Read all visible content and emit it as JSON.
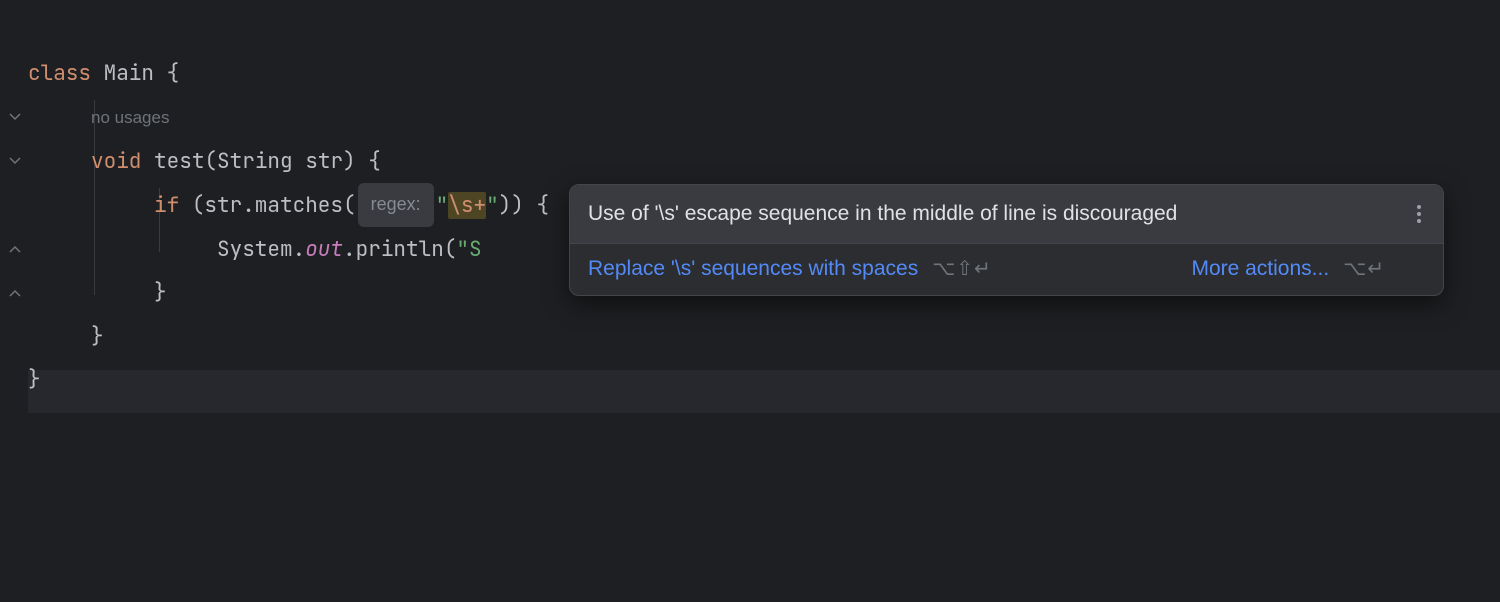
{
  "code": {
    "kw_class": "class",
    "class_name": "Main",
    "brace_open": " {",
    "usage_hint": "no usages",
    "kw_void": "void",
    "method_name": "test",
    "params_open": "(",
    "param_type": "String",
    "param_name": " str",
    "params_close": ") {",
    "kw_if": "if",
    "if_open": " (str.matches(",
    "param_hint": " regex: ",
    "str_open": "\"",
    "str_esc": "\\s+",
    "str_close": "\"",
    "if_close": ")) {",
    "sys": "System.",
    "out": "out",
    "println_open": ".println(",
    "println_arg_q": "\"",
    "println_arg_rest": "S",
    "inner_close": "}",
    "method_close": "}",
    "class_close": "}"
  },
  "popup": {
    "title": "Use of '\\s' escape sequence in the middle of line is discouraged",
    "action_primary": "Replace '\\s' sequences with spaces",
    "shortcut_primary": "⌥⇧↵",
    "action_more": "More actions...",
    "shortcut_more": "⌥↵"
  }
}
